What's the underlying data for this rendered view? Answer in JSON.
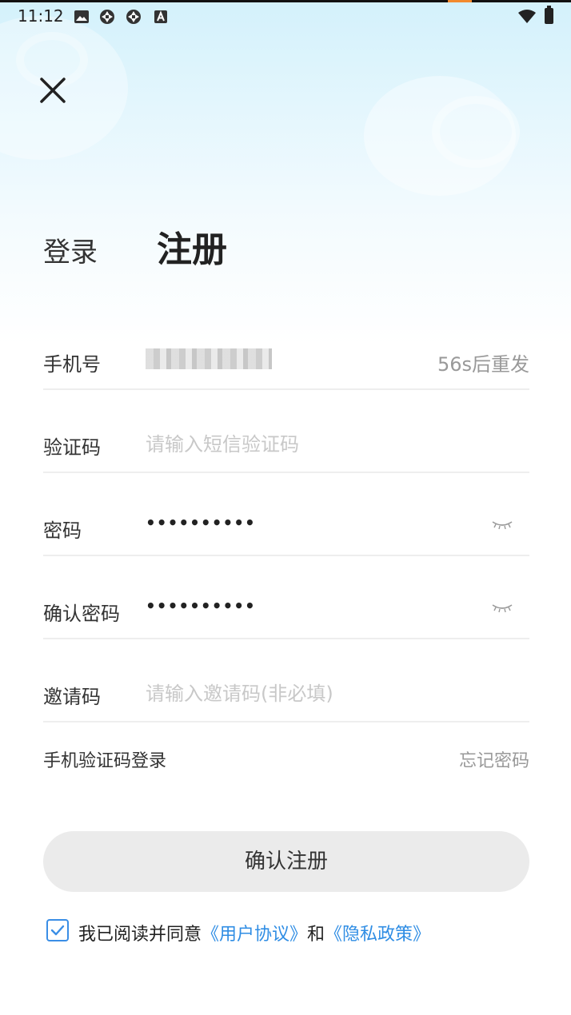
{
  "status_bar": {
    "time": "11:12",
    "icons": [
      "image-icon",
      "sync-icon",
      "sync-icon",
      "a-icon"
    ],
    "right_icons": [
      "wifi-icon",
      "battery-charging-icon"
    ]
  },
  "tabs": {
    "login": "登录",
    "register": "注册"
  },
  "form": {
    "phone": {
      "label": "手机号",
      "resend": "56s后重发"
    },
    "code": {
      "label": "验证码",
      "placeholder": "请输入短信验证码"
    },
    "password": {
      "label": "密码",
      "value": "••••••••••"
    },
    "confirm": {
      "label": "确认密码",
      "value": "••••••••••"
    },
    "invite": {
      "label": "邀请码",
      "placeholder": "请输入邀请码(非必填)"
    }
  },
  "links": {
    "sms_login": "手机验证码登录",
    "forgot": "忘记密码"
  },
  "submit_label": "确认注册",
  "agreement": {
    "checked": true,
    "prefix": "我已阅读并同意",
    "user_agreement": "《用户协议》",
    "and": "和",
    "privacy_policy": "《隐私政策》"
  },
  "colors": {
    "link": "#2f8de4",
    "button_bg": "#ebebeb",
    "header_gradient": "#d3f1fb"
  }
}
